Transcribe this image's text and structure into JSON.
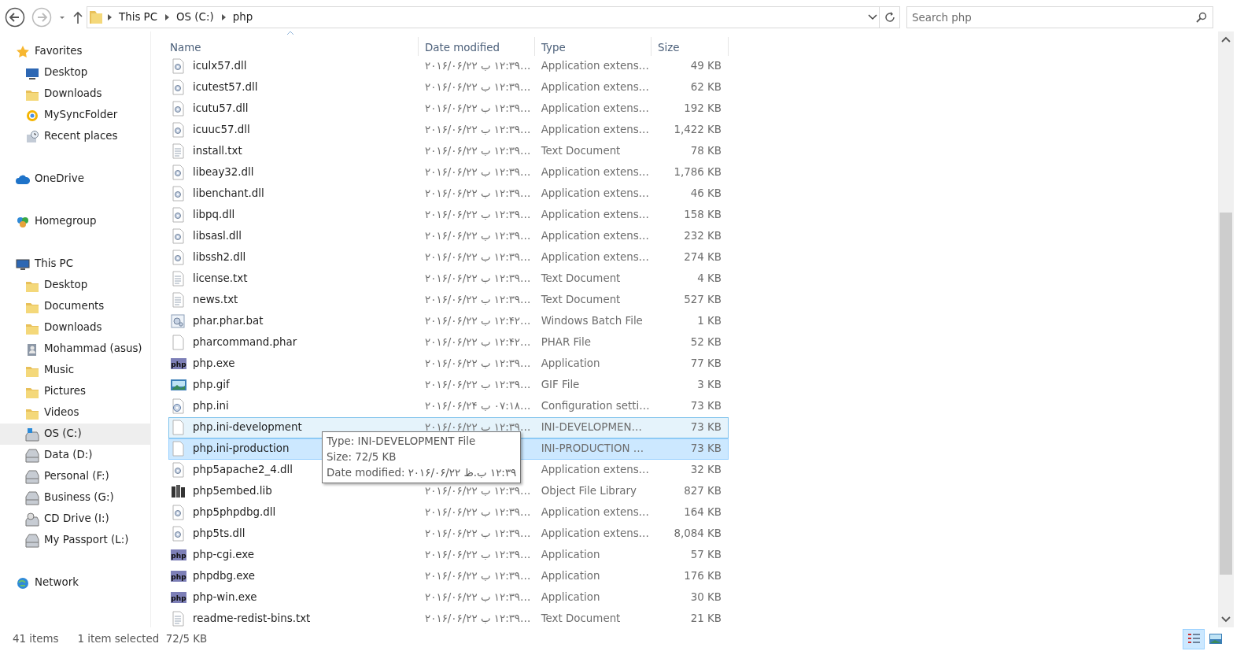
{
  "toolbar": {
    "breadcrumb": [
      "This PC",
      "OS (C:)",
      "php"
    ],
    "search": {
      "placeholder": "Search php"
    },
    "back_disabled": false,
    "forward_disabled": true
  },
  "sidebar": [
    {
      "label": "Favorites",
      "kind": "star",
      "selected": false,
      "items": [
        {
          "label": "Desktop",
          "kind": "desktop",
          "selected": false
        },
        {
          "label": "Downloads",
          "kind": "folder",
          "selected": false
        },
        {
          "label": "MySyncFolder",
          "kind": "sync",
          "selected": false
        },
        {
          "label": "Recent places",
          "kind": "recent",
          "selected": false
        }
      ]
    },
    {
      "label": "OneDrive",
      "kind": "cloud",
      "selected": false
    },
    {
      "label": "Homegroup",
      "kind": "homegroup",
      "selected": false
    },
    {
      "label": "This PC",
      "kind": "pc",
      "selected": false,
      "items": [
        {
          "label": "Desktop",
          "kind": "folder",
          "selected": false
        },
        {
          "label": "Documents",
          "kind": "folder",
          "selected": false
        },
        {
          "label": "Downloads",
          "kind": "folder",
          "selected": false
        },
        {
          "label": "Mohammad (asus)",
          "kind": "user",
          "selected": false
        },
        {
          "label": "Music",
          "kind": "folder",
          "selected": false
        },
        {
          "label": "Pictures",
          "kind": "folder",
          "selected": false
        },
        {
          "label": "Videos",
          "kind": "folder",
          "selected": false
        },
        {
          "label": "OS (C:)",
          "kind": "osdrive",
          "selected": true
        },
        {
          "label": "Data (D:)",
          "kind": "drive",
          "selected": false
        },
        {
          "label": "Personal (F:)",
          "kind": "drive",
          "selected": false
        },
        {
          "label": "Business (G:)",
          "kind": "drive",
          "selected": false
        },
        {
          "label": "CD Drive (I:)",
          "kind": "cd",
          "selected": false
        },
        {
          "label": "My Passport (L:)",
          "kind": "drive",
          "selected": false
        }
      ]
    },
    {
      "label": "Network",
      "kind": "network",
      "selected": false
    }
  ],
  "table": {
    "columns": [
      "Name",
      "Date modified",
      "Type",
      "Size"
    ],
    "rows": [
      {
        "kind": "dll",
        "name": "iculx57.dll",
        "date": "۲۰۱۶/۰۶/۲۲ ب ۱۲:۳۹…",
        "type": "Application extens…",
        "size": "49 KB",
        "selected": false,
        "hovered": false
      },
      {
        "kind": "dll",
        "name": "icutest57.dll",
        "date": "۲۰۱۶/۰۶/۲۲ ب ۱۲:۳۹…",
        "type": "Application extens…",
        "size": "62 KB",
        "selected": false,
        "hovered": false
      },
      {
        "kind": "dll",
        "name": "icutu57.dll",
        "date": "۲۰۱۶/۰۶/۲۲ ب ۱۲:۳۹…",
        "type": "Application extens…",
        "size": "192 KB",
        "selected": false,
        "hovered": false
      },
      {
        "kind": "dll",
        "name": "icuuc57.dll",
        "date": "۲۰۱۶/۰۶/۲۲ ب ۱۲:۳۹…",
        "type": "Application extens…",
        "size": "1,422 KB",
        "selected": false,
        "hovered": false
      },
      {
        "kind": "text",
        "name": "install.txt",
        "date": "۲۰۱۶/۰۶/۲۲ ب ۱۲:۳۹…",
        "type": "Text Document",
        "size": "78 KB",
        "selected": false,
        "hovered": false
      },
      {
        "kind": "dll",
        "name": "libeay32.dll",
        "date": "۲۰۱۶/۰۶/۲۲ ب ۱۲:۳۹…",
        "type": "Application extens…",
        "size": "1,786 KB",
        "selected": false,
        "hovered": false
      },
      {
        "kind": "dll",
        "name": "libenchant.dll",
        "date": "۲۰۱۶/۰۶/۲۲ ب ۱۲:۳۹…",
        "type": "Application extens…",
        "size": "46 KB",
        "selected": false,
        "hovered": false
      },
      {
        "kind": "dll",
        "name": "libpq.dll",
        "date": "۲۰۱۶/۰۶/۲۲ ب ۱۲:۳۹…",
        "type": "Application extens…",
        "size": "158 KB",
        "selected": false,
        "hovered": false
      },
      {
        "kind": "dll",
        "name": "libsasl.dll",
        "date": "۲۰۱۶/۰۶/۲۲ ب ۱۲:۳۹…",
        "type": "Application extens…",
        "size": "232 KB",
        "selected": false,
        "hovered": false
      },
      {
        "kind": "dll",
        "name": "libssh2.dll",
        "date": "۲۰۱۶/۰۶/۲۲ ب ۱۲:۳۹…",
        "type": "Application extens…",
        "size": "274 KB",
        "selected": false,
        "hovered": false
      },
      {
        "kind": "text",
        "name": "license.txt",
        "date": "۲۰۱۶/۰۶/۲۲ ب ۱۲:۳۹…",
        "type": "Text Document",
        "size": "4 KB",
        "selected": false,
        "hovered": false
      },
      {
        "kind": "text",
        "name": "news.txt",
        "date": "۲۰۱۶/۰۶/۲۲ ب ۱۲:۳۹…",
        "type": "Text Document",
        "size": "527 KB",
        "selected": false,
        "hovered": false
      },
      {
        "kind": "bat",
        "name": "phar.phar.bat",
        "date": "۲۰۱۶/۰۶/۲۲ ب ۱۲:۴۲…",
        "type": "Windows Batch File",
        "size": "1 KB",
        "selected": false,
        "hovered": false
      },
      {
        "kind": "blank",
        "name": "pharcommand.phar",
        "date": "۲۰۱۶/۰۶/۲۲ ب ۱۲:۴۲…",
        "type": "PHAR File",
        "size": "52 KB",
        "selected": false,
        "hovered": false
      },
      {
        "kind": "php",
        "name": "php.exe",
        "date": "۲۰۱۶/۰۶/۲۲ ب ۱۲:۳۹…",
        "type": "Application",
        "size": "77 KB",
        "selected": false,
        "hovered": false
      },
      {
        "kind": "image",
        "name": "php.gif",
        "date": "۲۰۱۶/۰۶/۲۲ ب ۱۲:۳۹…",
        "type": "GIF File",
        "size": "3 KB",
        "selected": false,
        "hovered": false
      },
      {
        "kind": "config",
        "name": "php.ini",
        "date": "۲۰۱۶/۰۶/۲۴ ب ۰۷:۱۸…",
        "type": "Configuration setti…",
        "size": "73 KB",
        "selected": false,
        "hovered": false
      },
      {
        "kind": "blank",
        "name": "php.ini-development",
        "date": "۲۰۱۶/۰۶/۲۲ ب ۱۲:۳۹…",
        "type": "INI-DEVELOPMEN…",
        "size": "73 KB",
        "selected": false,
        "hovered": true
      },
      {
        "kind": "blank",
        "name": "php.ini-production",
        "type": "INI-PRODUCTION …",
        "size": "73 KB",
        "selected": true,
        "hovered": false
      },
      {
        "kind": "dll",
        "name": "php5apache2_4.dll",
        "type": "Application extens…",
        "size": "32 KB",
        "selected": false,
        "hovered": false
      },
      {
        "kind": "library",
        "name": "php5embed.lib",
        "date": "۲۰۱۶/۰۶/۲۲ ب ۱۲:۳۹…",
        "type": "Object File Library",
        "size": "827 KB",
        "selected": false,
        "hovered": false
      },
      {
        "kind": "dll",
        "name": "php5phpdbg.dll",
        "date": "۲۰۱۶/۰۶/۲۲ ب ۱۲:۳۹…",
        "type": "Application extens…",
        "size": "164 KB",
        "selected": false,
        "hovered": false
      },
      {
        "kind": "dll",
        "name": "php5ts.dll",
        "date": "۲۰۱۶/۰۶/۲۲ ب ۱۲:۳۹…",
        "type": "Application extens…",
        "size": "8,084 KB",
        "selected": false,
        "hovered": false
      },
      {
        "kind": "php",
        "name": "php-cgi.exe",
        "date": "۲۰۱۶/۰۶/۲۲ ب ۱۲:۳۹…",
        "type": "Application",
        "size": "57 KB",
        "selected": false,
        "hovered": false
      },
      {
        "kind": "php",
        "name": "phpdbg.exe",
        "date": "۲۰۱۶/۰۶/۲۲ ب ۱۲:۳۹…",
        "type": "Application",
        "size": "176 KB",
        "selected": false,
        "hovered": false
      },
      {
        "kind": "php",
        "name": "php-win.exe",
        "date": "۲۰۱۶/۰۶/۲۲ ب ۱۲:۳۹…",
        "type": "Application",
        "size": "30 KB",
        "selected": false,
        "hovered": false
      },
      {
        "kind": "text",
        "name": "readme-redist-bins.txt",
        "date": "۲۰۱۶/۰۶/۲۲ ب ۱۲:۳۹…",
        "type": "Text Document",
        "size": "21 KB",
        "selected": false,
        "hovered": false
      }
    ]
  },
  "tooltip": {
    "lines": [
      "Type: INI-DEVELOPMENT File",
      "Size: 72/5 KB",
      "Date modified: ۲۰۱۶/۰۶/۲۲ ظ.ب ۱۲:۳۹"
    ]
  },
  "status_bar": {
    "items": "41 items",
    "selection": "1 item selected  72/5 KB",
    "views": [
      {
        "kind": "details",
        "selected": true
      },
      {
        "kind": "thumbnails",
        "selected": false
      }
    ]
  }
}
